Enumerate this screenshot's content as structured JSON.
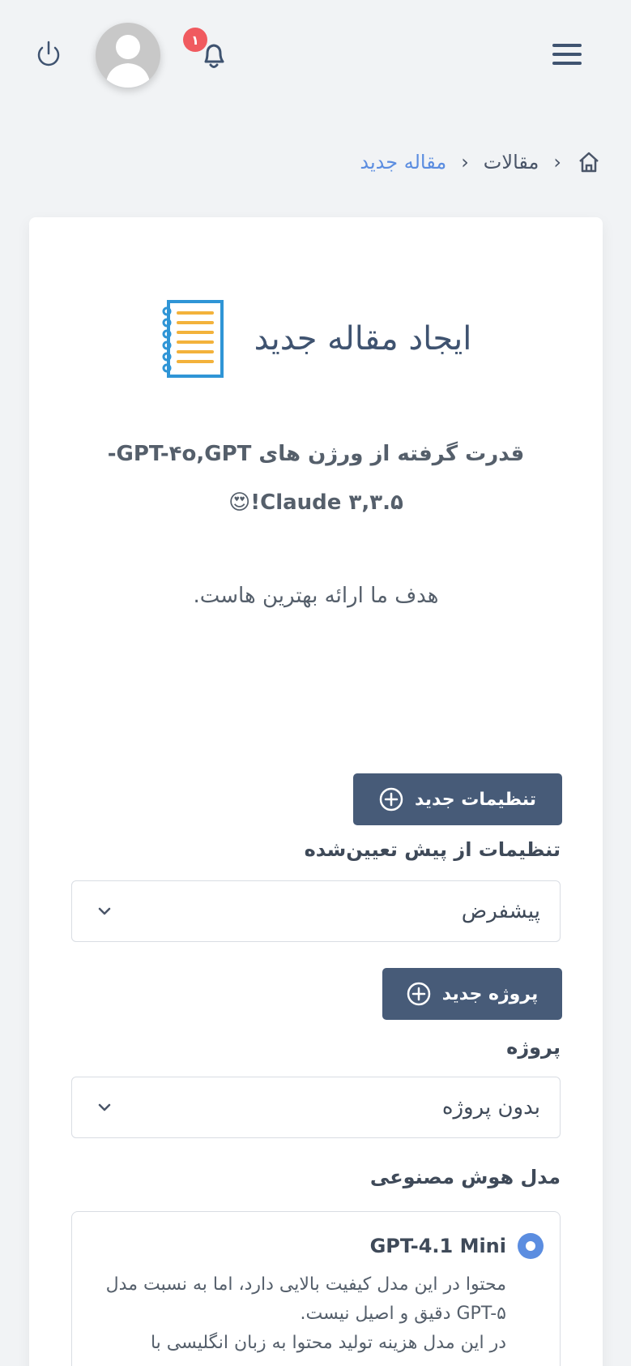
{
  "header": {
    "notification_count": "۱"
  },
  "breadcrumb": {
    "items": [
      "مقالات"
    ],
    "current": "مقاله جدید"
  },
  "card": {
    "title": "ایجاد مقاله جدید",
    "subtitle_line1": "قدرت گرفته از ورژن های GPT-۴o,GPT-",
    "subtitle_line2": "۳.۵,Claude ۳!",
    "subtitle_emoji": "😍",
    "goal": "هدف ما ارائه بهترین هاست."
  },
  "presets": {
    "new_button_label": "تنظیمات جدید",
    "label": "تنظیمات از پیش تعیین‌شده",
    "selected": "پیشفرض"
  },
  "project": {
    "new_button_label": "پروژه جدید",
    "label": "پروژه",
    "selected": "بدون پروژه"
  },
  "ai_model": {
    "label": "مدل هوش مصنوعی",
    "name": "GPT-4.1 Mini",
    "description_1": "محتوا در این مدل کیفیت بالایی دارد، اما به نسبت مدل GPT-۵ دقیق و اصیل نیست.",
    "description_2": "در این مدل هزینه تولید محتوا به زبان انگلیسی با"
  },
  "colors": {
    "primary_button": "#475b78",
    "accent_blue": "#5b8de0",
    "badge_red": "#f05a5f"
  }
}
